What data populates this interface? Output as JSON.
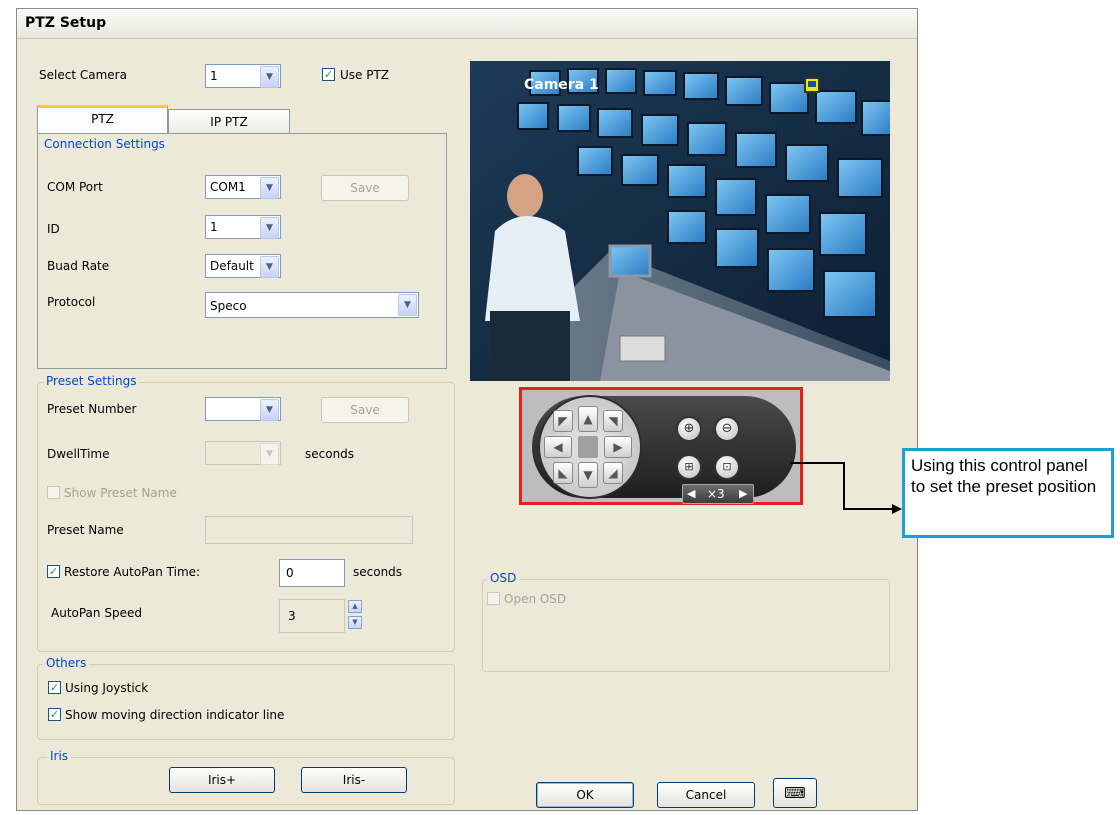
{
  "window": {
    "title": "PTZ Setup"
  },
  "camera": {
    "select_label": "Select Camera",
    "selected": "1",
    "use_ptz_label": "Use PTZ",
    "use_ptz_checked": true
  },
  "tabs": [
    {
      "label": "PTZ",
      "active": true
    },
    {
      "label": "IP PTZ",
      "active": false
    }
  ],
  "connection": {
    "legend": "Connection Settings",
    "com_port_label": "COM Port",
    "com_port_value": "COM1",
    "save_label": "Save",
    "id_label": "ID",
    "id_value": "1",
    "baud_label": "Buad Rate",
    "baud_value": "Default",
    "protocol_label": "Protocol",
    "protocol_value": "Speco"
  },
  "preset": {
    "legend": "Preset Settings",
    "number_label": "Preset Number",
    "number_value": "",
    "save_label": "Save",
    "dwell_label": "DwellTime",
    "dwell_unit": "seconds",
    "show_name_label": "Show Preset Name",
    "name_label": "Preset Name",
    "name_value": "",
    "restore_label": "Restore AutoPan Time:",
    "restore_value": "0",
    "restore_unit": "seconds",
    "speed_label": "AutoPan Speed",
    "speed_value": "3"
  },
  "others": {
    "legend": "Others",
    "joystick_label": "Using Joystick",
    "indicator_label": "Show moving direction indicator line"
  },
  "iris": {
    "legend": "Iris",
    "plus_label": "Iris+",
    "minus_label": "Iris-"
  },
  "preview": {
    "camera_label": "Camera 1"
  },
  "ptz_panel": {
    "zoom_level": "×3"
  },
  "osd": {
    "legend": "OSD",
    "open_label": "Open OSD"
  },
  "footer": {
    "ok_label": "OK",
    "cancel_label": "Cancel"
  },
  "callout": {
    "text": "Using this control panel to set the preset position"
  },
  "colors": {
    "highlight": "#e8201c",
    "callout_border": "#1e9ed8",
    "legend_blue": "#0046d5"
  }
}
